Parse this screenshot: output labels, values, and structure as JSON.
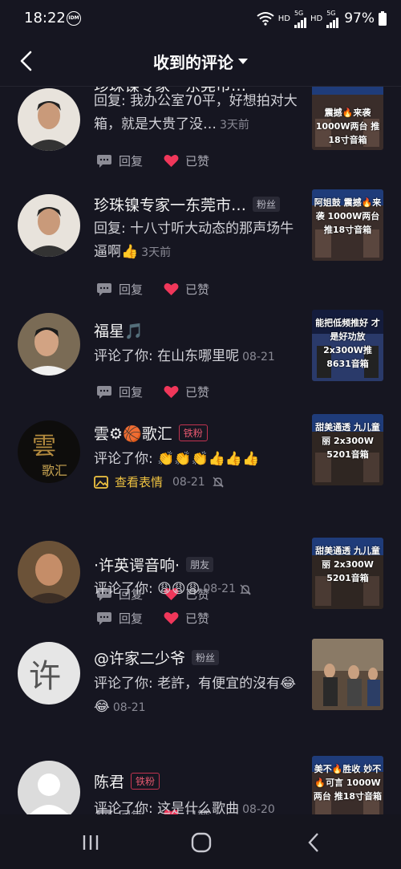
{
  "status_bar": {
    "time": "18:22",
    "idm_badge": "IDM",
    "network_labels": [
      "HD",
      "5G",
      "HD",
      "5G"
    ],
    "battery": "97%"
  },
  "header": {
    "title": "收到的评论",
    "back_icon": "chevron-left-icon",
    "dropdown_icon": "caret-down-icon"
  },
  "actions": {
    "reply_label": "回复",
    "liked_label": "已赞"
  },
  "comments": [
    {
      "name": "珍珠镍专家一东莞市…",
      "tag": "",
      "text": "回复: 我办公室70平，好想拍对大箱，就是大贵了没…",
      "time": "3天前",
      "thumb_text": "震撼🔥来袭 1000W两台 推18寸音箱"
    },
    {
      "name": "珍珠镍专家一东莞市…",
      "tag": "粉丝",
      "text": "回复: 十八寸听大动态的那声场牛逼啊👍",
      "time": "3天前",
      "thumb_text": "阿姐鼓 震撼🔥来袭 1000W两台 推18寸音箱"
    },
    {
      "name": "福星🎵",
      "tag": "",
      "text": "评论了你: 在山东哪里呢",
      "time": "08-21",
      "thumb_text": "能把低频推好 才是好功放 2x300W推 8631音箱"
    },
    {
      "name": "雲⚙🏀歌汇",
      "tag": "铁粉",
      "text": "评论了你: 👏👏👏👍👍👍",
      "time": "08-21",
      "sticker_label": "查看表情",
      "thumb_text": "甜美通透 九儿童丽 2x300W 5201音箱"
    },
    {
      "name": "·许英谔音响·",
      "tag": "朋友",
      "text": "评论了你: 😩😩😩",
      "time": "08-21",
      "thumb_text": "甜美通透 九儿童丽 2x300W 5201音箱"
    },
    {
      "name": "@许家二少爷",
      "tag": "粉丝",
      "text": "评论了你: 老許，有便宜的沒有😂😂",
      "time": "08-21",
      "thumb_text": ""
    },
    {
      "name": "陈君",
      "tag": "铁粉",
      "text": "评论了你: 这是什么歌曲",
      "time": "08-20",
      "thumb_text": "美不🔥胜收 妙不🔥可言 1000W两台 推18寸音箱"
    }
  ],
  "nav": {
    "recents_icon": "recents-icon",
    "home_icon": "home-icon",
    "back_icon": "back-icon"
  },
  "colors": {
    "background": "#161621",
    "heart": "#f0375a",
    "tag_red": "#e5586f",
    "sticker": "#f0c341"
  }
}
